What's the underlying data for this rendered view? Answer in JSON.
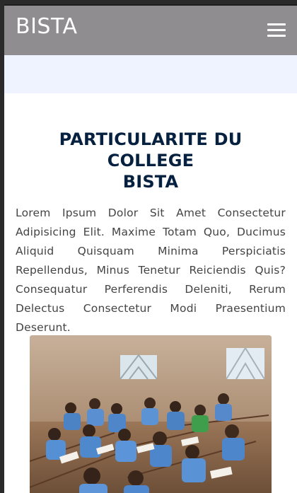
{
  "header": {
    "brand": "BISTA",
    "menu_icon": "hamburger-icon"
  },
  "section": {
    "title_line_1": "PARTICULARITE DU COLLEGE",
    "title_line_2": "BISTA",
    "body": "Lorem Ipsum Dolor Sit Amet Consectetur Adipisicing Elit. Maxime Totam Quo, Ducimus Aliquid Quisquam Minima Perspiciatis Repellendus, Minus Tenetur Reiciendis Quis? Consequatur Perferendis Deleniti, Rerum Delectus Consectetur Modi Praesentium Deserunt."
  },
  "image": {
    "subject": "students-classroom-photo"
  },
  "colors": {
    "header_bg": "#8f8d90",
    "band_bg": "#eef3ff",
    "title": "#06213f",
    "body_text": "#444444"
  }
}
